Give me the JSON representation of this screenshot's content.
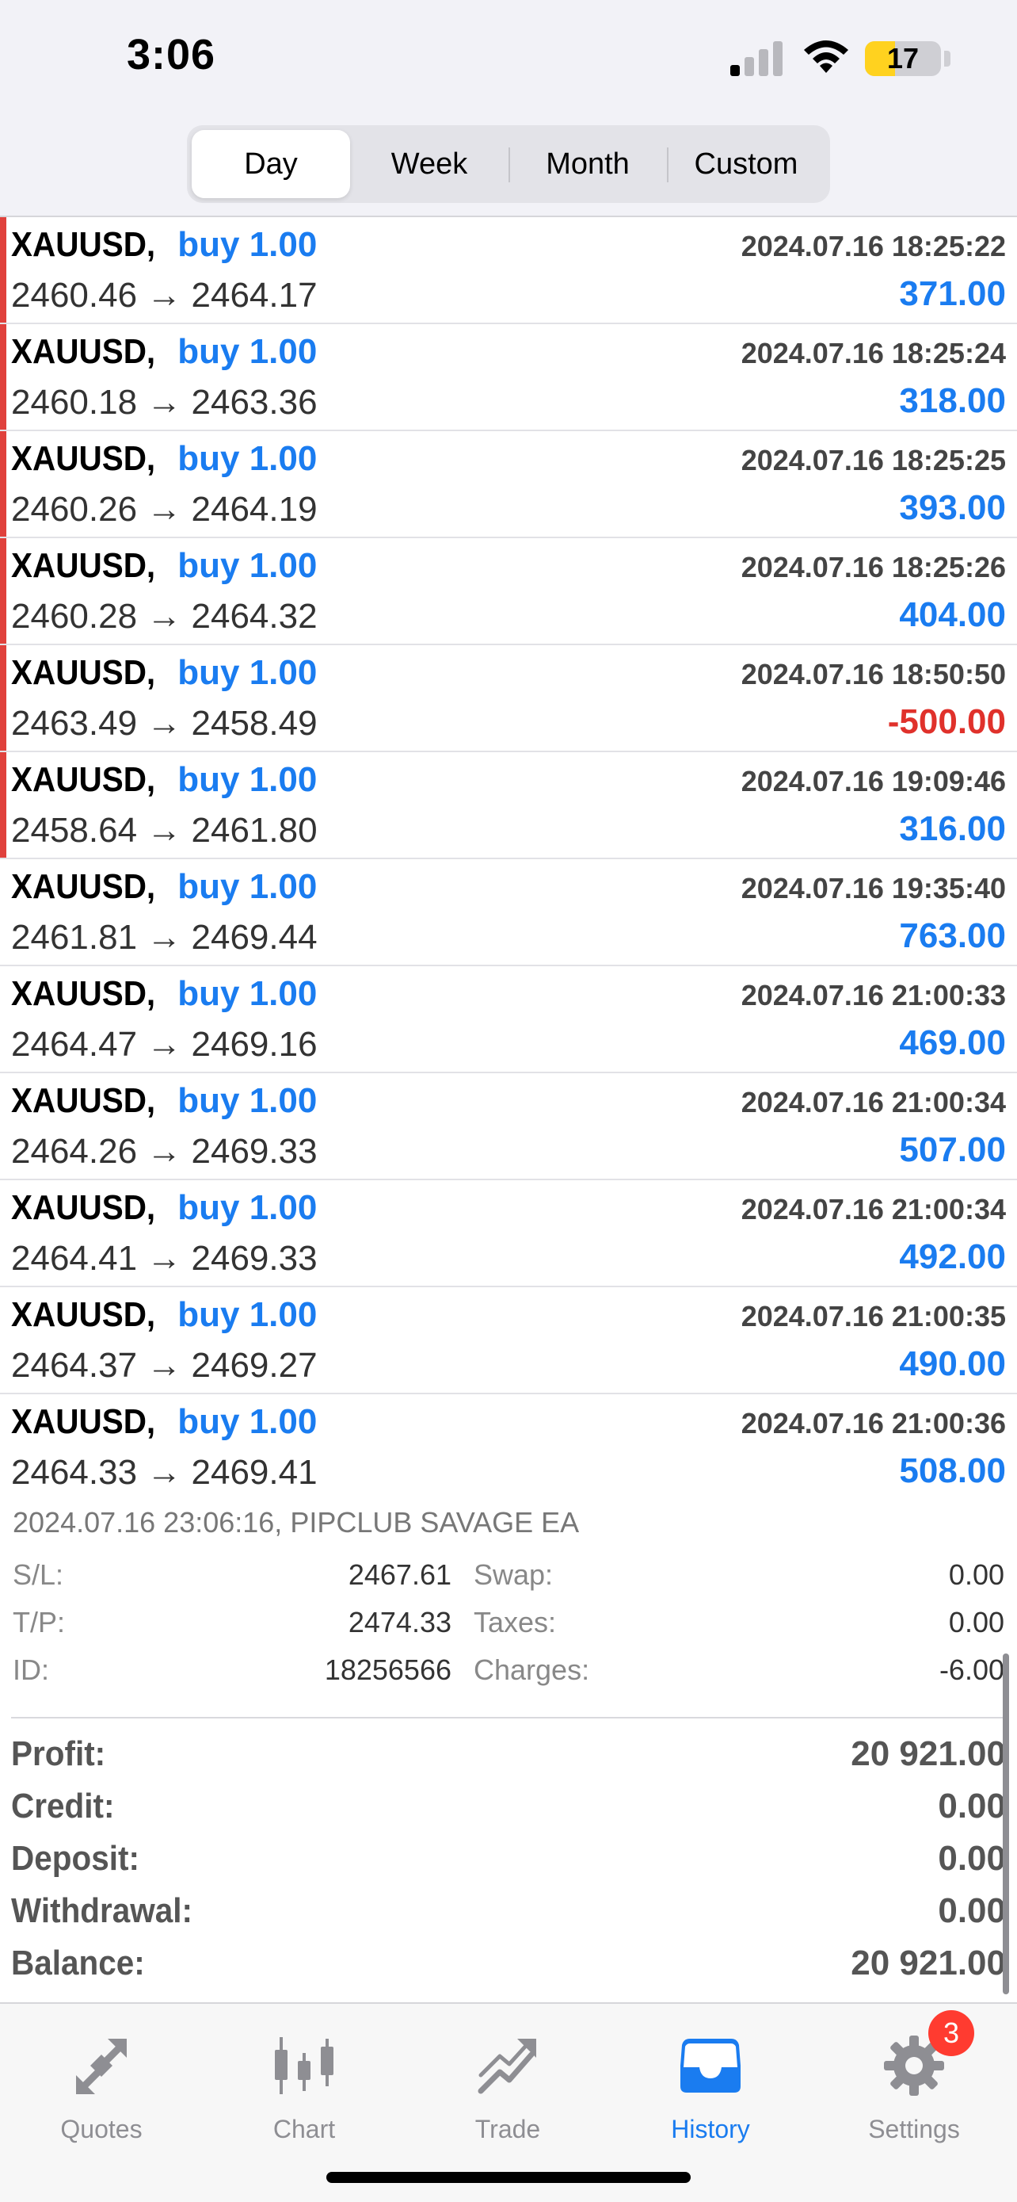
{
  "status": {
    "time": "3:06",
    "battery": "17"
  },
  "periods": [
    {
      "label": "Day",
      "active": true
    },
    {
      "label": "Week",
      "active": false
    },
    {
      "label": "Month",
      "active": false
    },
    {
      "label": "Custom",
      "active": false
    }
  ],
  "deals": [
    {
      "symbol": "XAUUSD,",
      "side": "buy 1.00",
      "time": "2024.07.16 18:25:22",
      "prices": "2460.46 → 2464.17",
      "profit": "371.00",
      "flag": true
    },
    {
      "symbol": "XAUUSD,",
      "side": "buy 1.00",
      "time": "2024.07.16 18:25:24",
      "prices": "2460.18 → 2463.36",
      "profit": "318.00",
      "flag": true
    },
    {
      "symbol": "XAUUSD,",
      "side": "buy 1.00",
      "time": "2024.07.16 18:25:25",
      "prices": "2460.26 → 2464.19",
      "profit": "393.00",
      "flag": true
    },
    {
      "symbol": "XAUUSD,",
      "side": "buy 1.00",
      "time": "2024.07.16 18:25:26",
      "prices": "2460.28 → 2464.32",
      "profit": "404.00",
      "flag": true
    },
    {
      "symbol": "XAUUSD,",
      "side": "buy 1.00",
      "time": "2024.07.16 18:50:50",
      "prices": "2463.49 → 2458.49",
      "profit": "-500.00",
      "flag": true
    },
    {
      "symbol": "XAUUSD,",
      "side": "buy 1.00",
      "time": "2024.07.16 19:09:46",
      "prices": "2458.64 → 2461.80",
      "profit": "316.00",
      "flag": true
    },
    {
      "symbol": "XAUUSD,",
      "side": "buy 1.00",
      "time": "2024.07.16 19:35:40",
      "prices": "2461.81 → 2469.44",
      "profit": "763.00",
      "flag": false
    },
    {
      "symbol": "XAUUSD,",
      "side": "buy 1.00",
      "time": "2024.07.16 21:00:33",
      "prices": "2464.47 → 2469.16",
      "profit": "469.00",
      "flag": false
    },
    {
      "symbol": "XAUUSD,",
      "side": "buy 1.00",
      "time": "2024.07.16 21:00:34",
      "prices": "2464.26 → 2469.33",
      "profit": "507.00",
      "flag": false
    },
    {
      "symbol": "XAUUSD,",
      "side": "buy 1.00",
      "time": "2024.07.16 21:00:34",
      "prices": "2464.41 → 2469.33",
      "profit": "492.00",
      "flag": false
    },
    {
      "symbol": "XAUUSD,",
      "side": "buy 1.00",
      "time": "2024.07.16 21:00:35",
      "prices": "2464.37 → 2469.27",
      "profit": "490.00",
      "flag": false
    },
    {
      "symbol": "XAUUSD,",
      "side": "buy 1.00",
      "time": "2024.07.16 21:00:36",
      "prices": "2464.33 → 2469.41",
      "profit": "508.00",
      "flag": false
    }
  ],
  "detail": {
    "header": "2024.07.16 23:06:16, PIPCLUB SAVAGE EA",
    "sl_label": "S/L:",
    "sl": "2467.61",
    "tp_label": "T/P:",
    "tp": "2474.33",
    "id_label": "ID:",
    "id": "18256566",
    "swap_label": "Swap:",
    "swap": "0.00",
    "taxes_label": "Taxes:",
    "taxes": "0.00",
    "charges_label": "Charges:",
    "charges": "-6.00"
  },
  "totals": [
    {
      "label": "Profit:",
      "value": "20 921.00"
    },
    {
      "label": "Credit:",
      "value": "0.00"
    },
    {
      "label": "Deposit:",
      "value": "0.00"
    },
    {
      "label": "Withdrawal:",
      "value": "0.00"
    },
    {
      "label": "Balance:",
      "value": "20 921.00"
    }
  ],
  "tabs": [
    {
      "label": "Quotes",
      "icon": "quotes-arrows-icon",
      "active": false
    },
    {
      "label": "Chart",
      "icon": "candlestick-icon",
      "active": false
    },
    {
      "label": "Trade",
      "icon": "trend-line-icon",
      "active": false
    },
    {
      "label": "History",
      "icon": "inbox-tray-icon",
      "active": true
    },
    {
      "label": "Settings",
      "icon": "gear-icon",
      "active": false
    }
  ],
  "settings_badge": "3",
  "colors": {
    "accent": "#1a7cf0",
    "loss": "#e0312b",
    "row_flag": "#e0413c"
  }
}
